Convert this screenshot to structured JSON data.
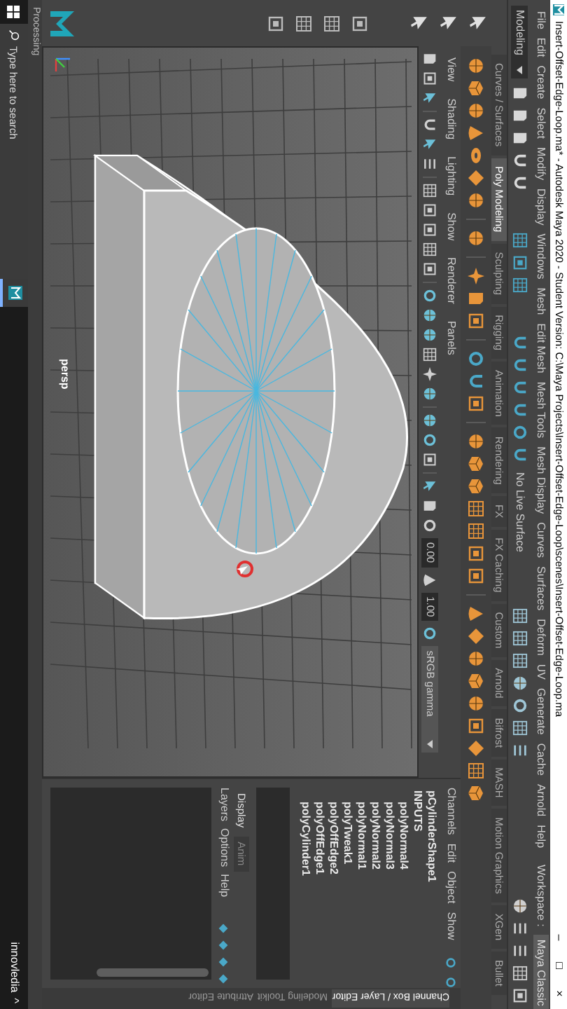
{
  "window": {
    "title": "Insert-Offset-Edge-Loop.ma* - Autodesk Maya 2020 - Student Version: C:\\Maya Projects\\Insert-Offset-Edge-Loop\\scenes\\Insert-Offset-Edge-Loop.ma",
    "controls": [
      "–",
      "□",
      "×"
    ]
  },
  "menu_bar": {
    "items": [
      "File",
      "Edit",
      "Create",
      "Select",
      "Modify",
      "Display",
      "Windows",
      "Mesh",
      "Edit Mesh",
      "Mesh Tools",
      "Mesh Display",
      "Curves",
      "Surfaces",
      "Deform",
      "UV",
      "Generate",
      "Cache",
      "Arnold",
      "Help"
    ],
    "workspace_label": "Workspace :",
    "workspace": "Maya Classic"
  },
  "status_line": {
    "menu_set": "Modeling",
    "live_surface": "No Live Surface"
  },
  "shelf": {
    "tabs": [
      {
        "label": "Curves / Surfaces",
        "selected": false
      },
      {
        "label": "Poly Modeling",
        "selected": true
      },
      {
        "label": "Sculpting",
        "selected": false
      },
      {
        "label": "Rigging",
        "selected": false
      },
      {
        "label": "Animation",
        "selected": false
      },
      {
        "label": "Rendering",
        "selected": false
      },
      {
        "label": "FX",
        "selected": false
      },
      {
        "label": "FX Caching",
        "selected": false
      },
      {
        "label": "Custom",
        "selected": false
      },
      {
        "label": "Arnold",
        "selected": false
      },
      {
        "label": "Bifrost",
        "selected": false
      },
      {
        "label": "MASH",
        "selected": false
      },
      {
        "label": "Motion Graphics",
        "selected": false
      },
      {
        "label": "XGen",
        "selected": false
      },
      {
        "label": "Bullet",
        "selected": false
      }
    ]
  },
  "panel": {
    "menus": [
      "View",
      "Shading",
      "Lighting",
      "Show",
      "Renderer",
      "Panels"
    ],
    "exposure": "0.00",
    "gamma": "1.00",
    "color_space": "sRGB gamma",
    "camera": "persp"
  },
  "channel_box": {
    "menus": [
      "Channels",
      "Edit",
      "Object",
      "Show"
    ],
    "object": "pCylinderShape1",
    "section": "INPUTS",
    "inputs": [
      "polyNormal4",
      "polyNormal3",
      "polyNormal2",
      "polyNormal1",
      "polyTweak1",
      "polyOffEdge2",
      "polyOffEdge1",
      "polyCylinder1"
    ]
  },
  "layer_editor": {
    "tabs": [
      {
        "label": "Display",
        "selected": true
      },
      {
        "label": "Anim",
        "selected": false
      }
    ],
    "menus": [
      "Layers",
      "Options",
      "Help"
    ]
  },
  "side_tabs": [
    {
      "label": "Channel Box / Layer Editor",
      "selected": true
    },
    {
      "label": "Modeling Toolkit",
      "selected": false
    },
    {
      "label": "Attribute Editor",
      "selected": false
    }
  ],
  "help_line": "Processing",
  "taskbar": {
    "search_placeholder": "Type here to search",
    "user": "innovledia",
    "tray": "^"
  }
}
